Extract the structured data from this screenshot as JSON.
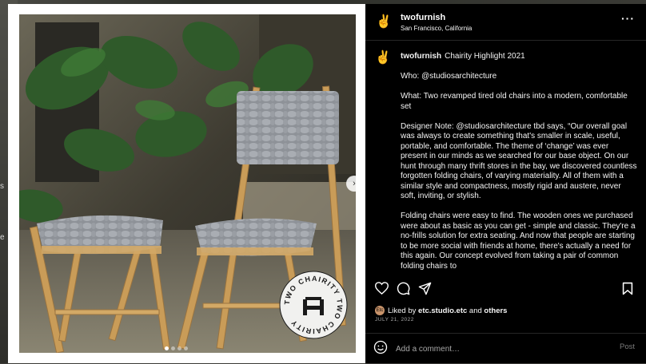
{
  "background": {
    "side_text_1": "s",
    "side_text_2": "e"
  },
  "post": {
    "author": {
      "username": "twofurnish",
      "location": "San Francisco, California",
      "avatar_icon": "peace-hand-icon"
    },
    "caption": {
      "username": "twofurnish",
      "title": "Chairity Highlight 2021",
      "paragraphs": [
        "Who: @studiosarchitecture",
        "What: Two revamped tired old chairs into a modern, comfortable set",
        "Designer Note: @studiosarchitecture tbd says, “Our overall goal was always to create something that's smaller in scale, useful, portable, and comfortable. The theme of ‘change’ was ever present in our minds as we searched for our base object. On our hunt through many thrift stores in the bay, we discovered countless forgotten folding chairs, of varying materiality. All of them with a similar style and compactness, mostly rigid and austere, never soft, inviting, or stylish.",
        "Folding chairs were easy to find. The wooden ones we purchased were about as basic as you can get - simple and classic. They're a no-frills solution for extra seating. And now that people are starting to be more social with friends at home, there's actually a need for this again. Our concept evolved from taking a pair of common folding chairs to"
      ]
    },
    "likes": {
      "avatar_text": "Etc",
      "prefix": "Liked by",
      "user": "etc.studio.etc",
      "joiner": "and",
      "others": "others"
    },
    "date": "JULY 21, 2022",
    "comment": {
      "placeholder": "Add a comment…",
      "post_label": "Post"
    },
    "photo": {
      "seal_text": "TWO CHAIRITY TWO CHAIRITY",
      "carousel_position": 1,
      "carousel_count": 4
    }
  },
  "colors": {
    "panel_bg": "#000000",
    "text": "#f5f5f5",
    "muted": "#a8a8a8",
    "divider": "#262626"
  }
}
